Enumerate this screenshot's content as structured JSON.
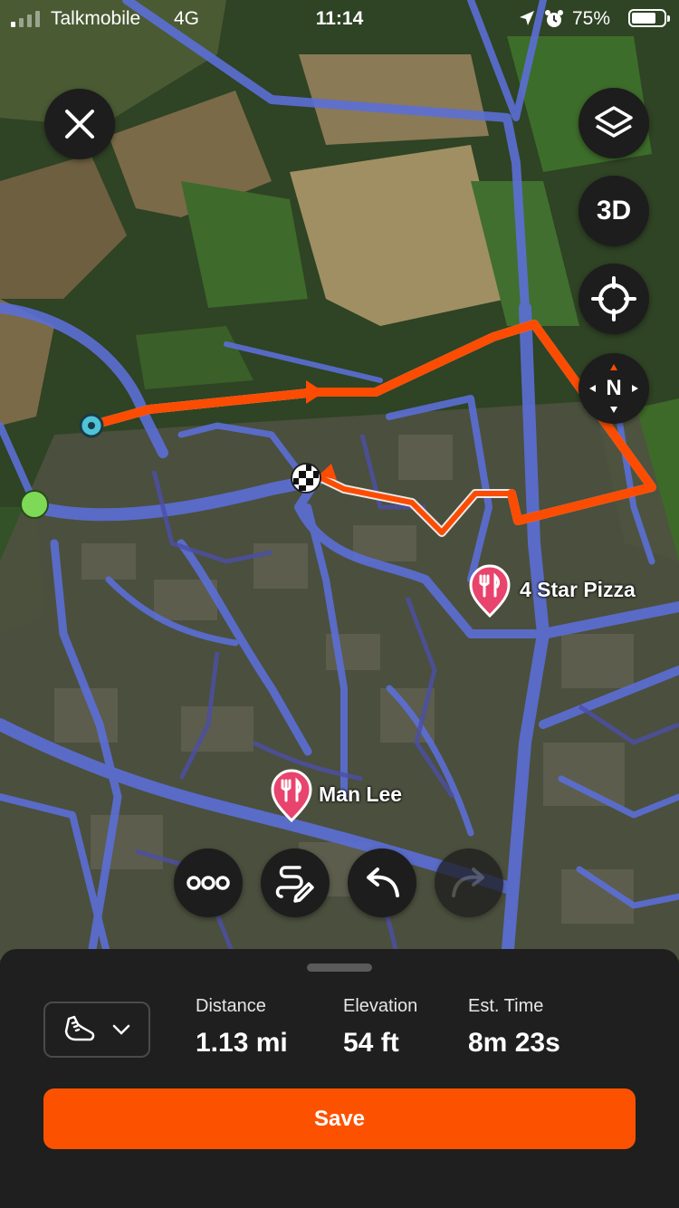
{
  "status_bar": {
    "carrier": "Talkmobile",
    "network": "4G",
    "time": "11:14",
    "battery": "75%",
    "battery_level": 0.75
  },
  "map": {
    "icons": {
      "close": "close-icon",
      "layers": "layers-icon",
      "view_3d": "3D",
      "locate": "crosshair-icon",
      "compass": "N"
    },
    "pois": [
      {
        "name": "4 Star Pizza",
        "icon": "restaurant-icon"
      },
      {
        "name": "Man Lee",
        "icon": "restaurant-icon"
      }
    ],
    "route_color": "#fc4c02",
    "road_color": "#5b6fd6"
  },
  "toolbar": {
    "more": "more-icon",
    "edit_route": "edit-route-icon",
    "undo": "undo-icon",
    "redo": "redo-icon"
  },
  "sheet": {
    "activity_icon": "running-shoe-icon",
    "stats": [
      {
        "label": "Distance",
        "value": "1.13 mi"
      },
      {
        "label": "Elevation",
        "value": "54 ft"
      },
      {
        "label": "Est. Time",
        "value": "8m 23s"
      }
    ],
    "save_label": "Save",
    "save_color": "#fc5200"
  }
}
